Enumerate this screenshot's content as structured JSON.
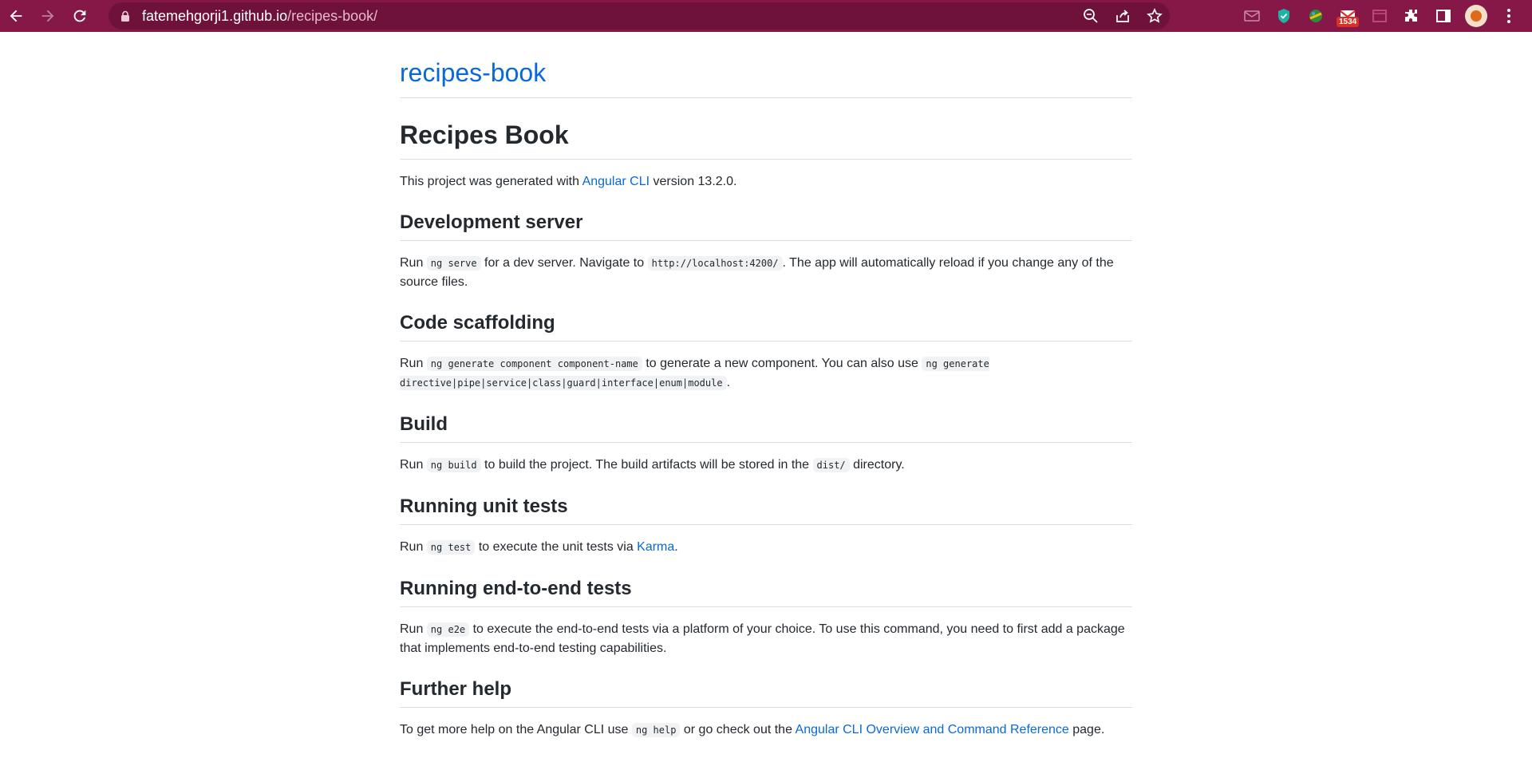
{
  "browser": {
    "url_host": "fatemehgorji1.github.io",
    "url_path": "/recipes-book/",
    "badge_count": "1534"
  },
  "page": {
    "site_title": "recipes-book",
    "heading": "Recipes Book",
    "intro": {
      "prefix": "This project was generated with ",
      "link": "Angular CLI",
      "suffix": " version 13.2.0."
    },
    "sections": [
      {
        "title": "Development server",
        "p1": "Run ",
        "c1": "ng serve",
        "p2": " for a dev server. Navigate to ",
        "c2": "http://localhost:4200/",
        "p3": ". The app will automatically reload if you change any of the source files."
      },
      {
        "title": "Code scaffolding",
        "p1": "Run ",
        "c1": "ng generate component component-name",
        "p2": " to generate a new component. You can also use ",
        "c2": "ng generate directive|pipe|service|class|guard|interface|enum|module",
        "p3": "."
      },
      {
        "title": "Build",
        "p1": "Run ",
        "c1": "ng build",
        "p2": " to build the project. The build artifacts will be stored in the ",
        "c2": "dist/",
        "p3": " directory."
      },
      {
        "title": "Running unit tests",
        "p1": "Run ",
        "c1": "ng test",
        "p2": " to execute the unit tests via ",
        "link": "Karma",
        "p3": "."
      },
      {
        "title": "Running end-to-end tests",
        "p1": "Run ",
        "c1": "ng e2e",
        "p2": " to execute the end-to-end tests via a platform of your choice. To use this command, you need to first add a package that implements end-to-end testing capabilities."
      },
      {
        "title": "Further help",
        "p1": "To get more help on the Angular CLI use ",
        "c1": "ng help",
        "p2": " or go check out the ",
        "link": "Angular CLI Overview and Command Reference",
        "p3": " page."
      }
    ]
  }
}
